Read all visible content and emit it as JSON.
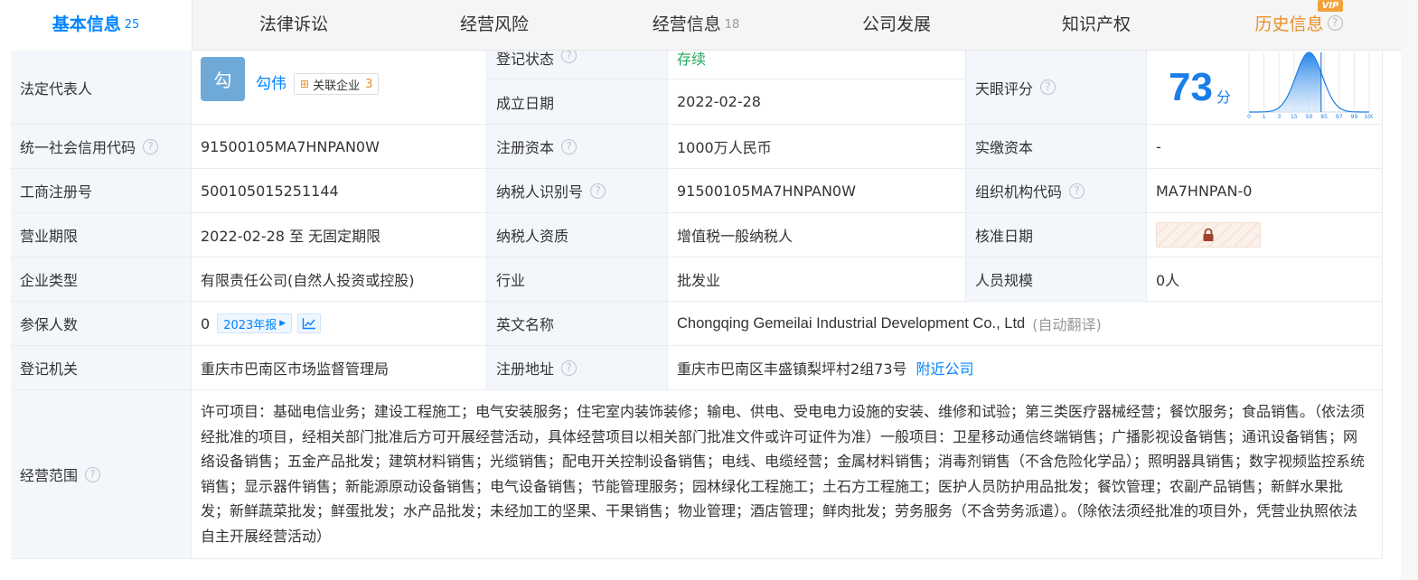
{
  "tabs": [
    {
      "label": "基本信息",
      "count": "25"
    },
    {
      "label": "法律诉讼",
      "count": ""
    },
    {
      "label": "经营风险",
      "count": ""
    },
    {
      "label": "经营信息",
      "count": "18"
    },
    {
      "label": "公司发展",
      "count": ""
    },
    {
      "label": "知识产权",
      "count": ""
    },
    {
      "label": "历史信息",
      "count": ""
    }
  ],
  "vip_badge": "VIP",
  "help_mark": "?",
  "legal_rep": {
    "label": "法定代表人",
    "avatar_char": "勾",
    "name": "勾伟",
    "assoc_label": "关联企业",
    "assoc_count": "3"
  },
  "reg_status": {
    "label": "登记状态",
    "value": "存续"
  },
  "found_date": {
    "label": "成立日期",
    "value": "2022-02-28"
  },
  "tianyan": {
    "label": "天眼评分",
    "score": "73",
    "unit": "分",
    "axis_ticks": [
      "0",
      "1",
      "3",
      "15",
      "50",
      "85",
      "97",
      "99",
      "100"
    ],
    "score_fraction": 0.6
  },
  "rows": {
    "credit_code": {
      "label": "统一社会信用代码",
      "value": "91500105MA7HNPAN0W"
    },
    "reg_capital": {
      "label": "注册资本",
      "value": "1000万人民币"
    },
    "paid_capital": {
      "label": "实缴资本",
      "value": "-"
    },
    "biz_reg_no": {
      "label": "工商注册号",
      "value": "500105015251144"
    },
    "taxpayer_id": {
      "label": "纳税人识别号",
      "value": "91500105MA7HNPAN0W"
    },
    "org_code": {
      "label": "组织机构代码",
      "value": "MA7HNPAN-0"
    },
    "biz_term": {
      "label": "营业期限",
      "value": "2022-02-28 至 无固定期限"
    },
    "taxpayer_qual": {
      "label": "纳税人资质",
      "value": "增值税一般纳税人"
    },
    "approve_date": {
      "label": "核准日期",
      "value": ""
    },
    "company_type": {
      "label": "企业类型",
      "value": "有限责任公司(自然人投资或控股)"
    },
    "industry": {
      "label": "行业",
      "value": "批发业"
    },
    "staff_size": {
      "label": "人员规模",
      "value": "0人"
    },
    "insured": {
      "label": "参保人数",
      "value": "0",
      "year_btn": "2023年报"
    },
    "english_name": {
      "label": "英文名称",
      "value": "Chongqing Gemeilai Industrial Development Co., Ltd",
      "note": "(自动翻译)"
    },
    "reg_authority": {
      "label": "登记机关",
      "value": "重庆市巴南区市场监督管理局"
    },
    "reg_address": {
      "label": "注册地址",
      "value": "重庆市巴南区丰盛镇梨坪村2组73号",
      "link": "附近公司"
    }
  },
  "scope": {
    "label": "经营范围",
    "text": "许可项目：基础电信业务；建设工程施工；电气安装服务；住宅室内装饰装修；输电、供电、受电电力设施的安装、维修和试验；第三类医疗器械经营；餐饮服务；食品销售。（依法须经批准的项目，经相关部门批准后方可开展经营活动，具体经营项目以相关部门批准文件或许可证件为准）一般项目：卫星移动通信终端销售；广播影视设备销售；通讯设备销售；网络设备销售；五金产品批发；建筑材料销售；光缆销售；配电开关控制设备销售；电线、电缆经营；金属材料销售；消毒剂销售（不含危险化学品）；照明器具销售；数字视频监控系统销售；显示器件销售；新能源原动设备销售；电气设备销售；节能管理服务；园林绿化工程施工；土石方工程施工；医护人员防护用品批发；餐饮管理；农副产品销售；新鲜水果批发；新鲜蔬菜批发；鲜蛋批发；水产品批发；未经加工的坚果、干果销售；物业管理；酒店管理；鲜肉批发；劳务服务（不含劳务派遣）。（除依法须经批准的项目外，凭营业执照依法自主开展经营活动）"
  },
  "colors": {
    "accent": "#0084ff",
    "status_green": "#23a85e",
    "history_orange": "#e8902a",
    "label_bg": "#f3f6fa"
  }
}
